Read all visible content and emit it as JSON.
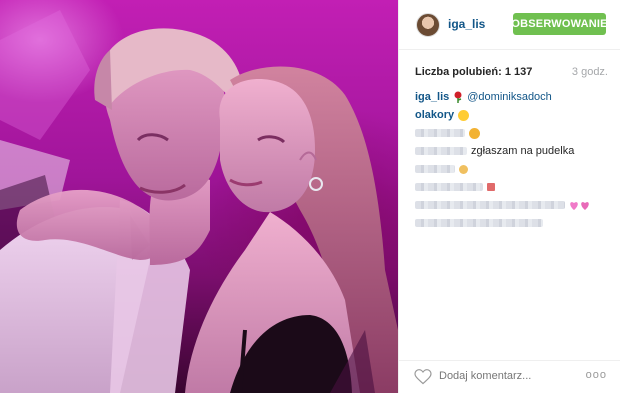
{
  "post": {
    "username": "iga_lis",
    "follow_label": "OBSERWOWANIE",
    "likes_text": "Liczba polubień: 1 137",
    "time_text": "3 godz.",
    "caption_mention": "@dominiksadoch",
    "comments": [
      {
        "user": "olakory",
        "text": ""
      },
      {
        "user": "",
        "text": "zgłaszam na pudelka"
      }
    ],
    "comment_placeholder": "Dodaj komentarz...",
    "more_label": "ooo"
  },
  "colors": {
    "username": "#125688",
    "follow_button": "#70c050",
    "photo_magenta": "#c21fb4"
  },
  "icons": {
    "heart": "heart-icon",
    "rose": "rose-icon",
    "smile": "smile-icon",
    "cat": "cat-icon",
    "sparkle_hearts": "sparkle-heart-icon",
    "more": "more-icon"
  }
}
